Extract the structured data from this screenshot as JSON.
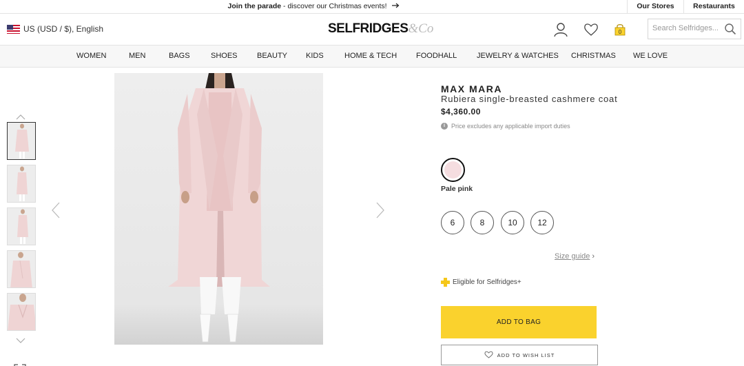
{
  "promo": {
    "bold": "Join the parade",
    "text": " - discover our Christmas events!",
    "arrow_icon": "arrow-right-icon",
    "links": [
      "Our Stores",
      "Restaurants"
    ]
  },
  "header": {
    "locale": "US (USD / $), English",
    "logo_main": "SELFRIDGES",
    "logo_suffix": "&Co",
    "bag_count": "0",
    "search_placeholder": "Search Selfridges...",
    "icons": [
      "account-icon",
      "wishlist-heart-icon",
      "shopping-bag-icon",
      "search-icon"
    ]
  },
  "nav": {
    "items": [
      "WOMEN",
      "MEN",
      "BAGS",
      "SHOES",
      "BEAUTY",
      "KIDS",
      "HOME & TECH",
      "FOODHALL",
      "JEWELRY & WATCHES",
      "CHRISTMAS",
      "WE LOVE"
    ]
  },
  "product": {
    "brand": "MAX MARA",
    "name": "Rubiera single-breasted cashmere coat",
    "price": "$4,360.00",
    "duty_note": "Price excludes any applicable import duties",
    "colour": "Pale pink",
    "colour_hex": "#f5dde0",
    "sizes": [
      "6",
      "8",
      "10",
      "12"
    ],
    "size_guide": "Size guide",
    "plus_text": "Eligible for Selfridges+",
    "add_to_bag": "ADD TO BAG",
    "add_to_wish": "ADD TO WISH LIST"
  },
  "colors": {
    "accent_yellow": "#fad22d",
    "product_pink": "#f0d6d6"
  }
}
